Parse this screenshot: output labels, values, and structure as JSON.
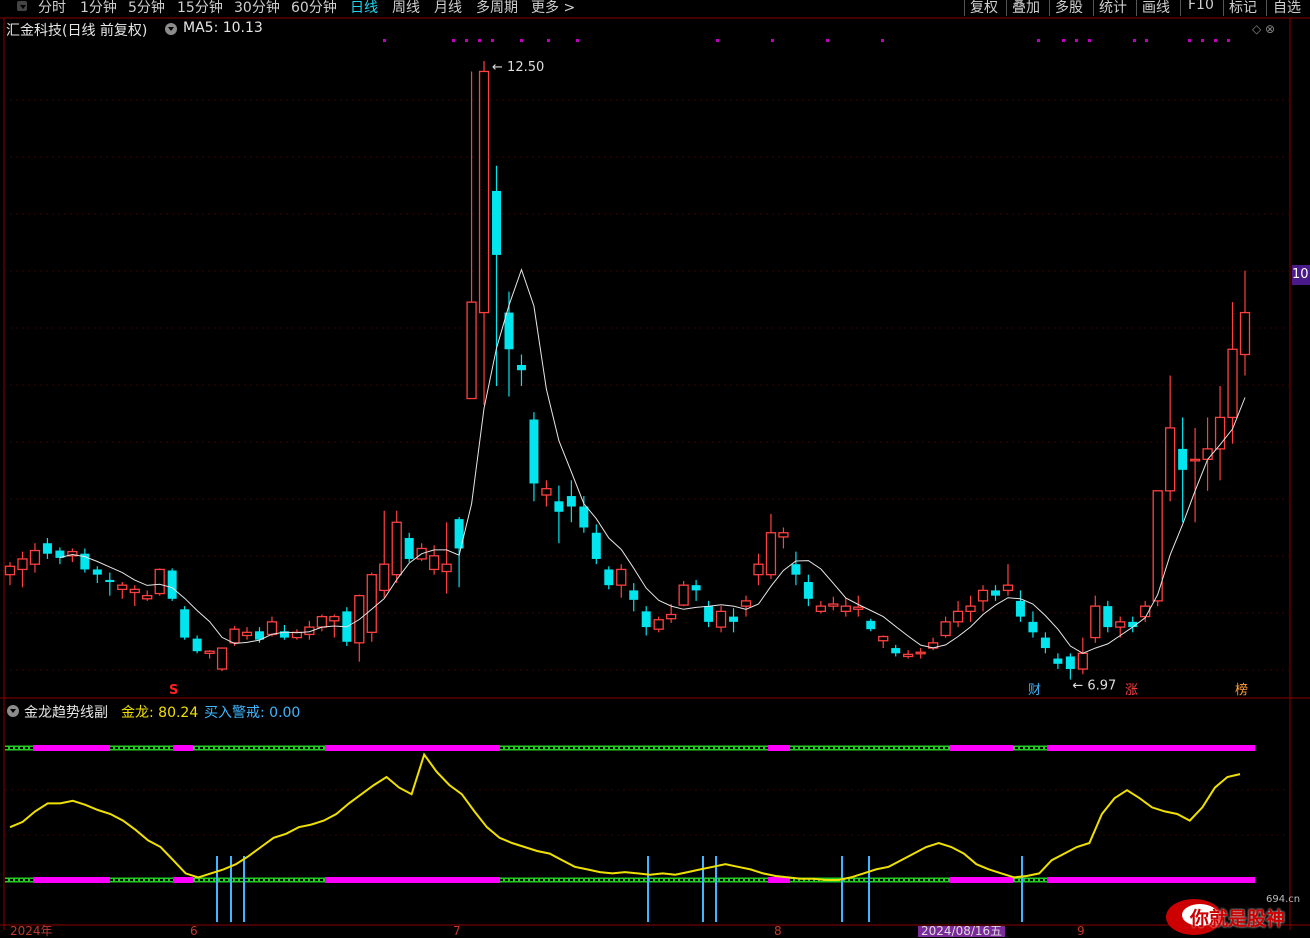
{
  "toolbar": {
    "periods": [
      "分时",
      "1分钟",
      "5分钟",
      "15分钟",
      "30分钟",
      "60分钟",
      "日线",
      "周线",
      "月线",
      "多周期",
      "更多 >"
    ],
    "active_period": "日线",
    "right_buttons": [
      "复权",
      "叠加",
      "多股",
      "统计",
      "画线",
      "F10",
      "标记",
      "自选"
    ]
  },
  "chart": {
    "title": "汇金科技(日线 前复权)",
    "ma_label": "MA5: 10.13",
    "high_label": "12.50",
    "low_label": "6.97",
    "right_price": "10",
    "markers": {
      "s": "S",
      "cai": "财",
      "zhang": "涨",
      "bang": "榜"
    }
  },
  "indicator": {
    "title": "金龙趋势线副",
    "gold_label": "金龙: 80.24",
    "alert_label": "买入警戒: 0.00"
  },
  "x_axis": {
    "labels": [
      "2024年",
      "6",
      "7",
      "8",
      "2024/08/16五",
      "9"
    ]
  },
  "watermark": {
    "text": "你就是股神",
    "site": "694.cn"
  },
  "colors": {
    "up": "#ff4040",
    "down": "#00e5ee",
    "ma": "#e6e6e6",
    "gold": "#f0e000",
    "magenta": "#ff00ff",
    "green": "#22cc22",
    "alert": "#3fb6ff"
  },
  "chart_data": {
    "type": "candlestick",
    "ma_period": 5,
    "candles": [
      [
        7.7,
        7.78,
        7.6,
        7.82
      ],
      [
        7.75,
        7.85,
        7.58,
        7.92
      ],
      [
        7.8,
        7.93,
        7.72,
        8.0
      ],
      [
        8.0,
        7.9,
        7.85,
        8.05
      ],
      [
        7.93,
        7.86,
        7.8,
        7.96
      ],
      [
        7.88,
        7.92,
        7.82,
        7.95
      ],
      [
        7.9,
        7.75,
        7.72,
        7.95
      ],
      [
        7.75,
        7.7,
        7.62,
        7.78
      ],
      [
        7.65,
        7.63,
        7.5,
        7.72
      ],
      [
        7.56,
        7.6,
        7.47,
        7.63
      ],
      [
        7.53,
        7.56,
        7.4,
        7.6
      ],
      [
        7.47,
        7.5,
        7.45,
        7.55
      ],
      [
        7.52,
        7.75,
        7.5,
        7.76
      ],
      [
        7.74,
        7.47,
        7.45,
        7.76
      ],
      [
        7.37,
        7.1,
        7.08,
        7.4
      ],
      [
        7.09,
        6.97,
        6.95,
        7.12
      ],
      [
        6.95,
        6.97,
        6.9,
        6.98
      ],
      [
        6.8,
        7.0,
        6.78,
        6.84
      ],
      [
        7.05,
        7.18,
        7.02,
        7.21
      ],
      [
        7.12,
        7.15,
        7.08,
        7.2
      ],
      [
        7.16,
        7.08,
        7.05,
        7.2
      ],
      [
        7.13,
        7.25,
        7.11,
        7.3
      ],
      [
        7.16,
        7.1,
        7.08,
        7.22
      ],
      [
        7.1,
        7.15,
        7.08,
        7.18
      ],
      [
        7.13,
        7.2,
        7.08,
        7.26
      ],
      [
        7.2,
        7.3,
        7.16,
        7.32
      ],
      [
        7.26,
        7.3,
        7.1,
        7.32
      ],
      [
        7.35,
        7.06,
        7.02,
        7.39
      ],
      [
        7.05,
        7.5,
        6.87,
        7.51
      ],
      [
        7.15,
        7.7,
        7.06,
        7.72
      ],
      [
        7.55,
        7.8,
        7.48,
        8.31
      ],
      [
        7.7,
        8.2,
        7.62,
        8.31
      ],
      [
        8.05,
        7.85,
        7.82,
        8.1
      ],
      [
        7.85,
        7.95,
        7.83,
        8.0
      ],
      [
        7.75,
        7.88,
        7.7,
        7.98
      ],
      [
        7.73,
        7.8,
        7.52,
        8.2
      ],
      [
        8.23,
        7.95,
        7.58,
        8.25
      ],
      [
        9.38,
        10.3,
        9.38,
        12.5
      ],
      [
        10.2,
        12.5,
        9.32,
        12.6
      ],
      [
        11.36,
        10.75,
        9.5,
        11.6
      ],
      [
        10.2,
        9.85,
        9.4,
        10.4
      ],
      [
        9.7,
        9.65,
        9.5,
        9.8
      ],
      [
        9.18,
        8.57,
        8.4,
        9.25
      ],
      [
        8.46,
        8.52,
        8.35,
        8.6
      ],
      [
        8.4,
        8.3,
        8.0,
        8.55
      ],
      [
        8.45,
        8.35,
        8.2,
        8.6
      ],
      [
        8.35,
        8.15,
        8.1,
        8.45
      ],
      [
        8.1,
        7.85,
        7.8,
        8.18
      ],
      [
        7.75,
        7.6,
        7.56,
        7.78
      ],
      [
        7.6,
        7.75,
        7.48,
        7.8
      ],
      [
        7.55,
        7.46,
        7.35,
        7.62
      ],
      [
        7.35,
        7.2,
        7.12,
        7.4
      ],
      [
        7.18,
        7.27,
        7.15,
        7.3
      ],
      [
        7.28,
        7.32,
        7.24,
        7.42
      ],
      [
        7.41,
        7.6,
        7.4,
        7.64
      ],
      [
        7.6,
        7.55,
        7.45,
        7.65
      ],
      [
        7.4,
        7.25,
        7.2,
        7.45
      ],
      [
        7.2,
        7.35,
        7.15,
        7.4
      ],
      [
        7.3,
        7.25,
        7.15,
        7.38
      ],
      [
        7.4,
        7.45,
        7.3,
        7.5
      ],
      [
        7.7,
        7.8,
        7.6,
        7.9
      ],
      [
        7.7,
        8.1,
        7.66,
        8.28
      ],
      [
        8.06,
        8.1,
        7.95,
        8.15
      ],
      [
        7.8,
        7.7,
        7.6,
        7.92
      ],
      [
        7.63,
        7.47,
        7.4,
        7.7
      ],
      [
        7.35,
        7.4,
        7.33,
        7.45
      ],
      [
        7.4,
        7.42,
        7.36,
        7.49
      ],
      [
        7.35,
        7.4,
        7.3,
        7.48
      ],
      [
        7.37,
        7.39,
        7.3,
        7.5
      ],
      [
        7.26,
        7.18,
        7.16,
        7.28
      ],
      [
        7.07,
        7.11,
        7.0,
        7.12
      ],
      [
        7.0,
        6.95,
        6.92,
        7.03
      ],
      [
        6.92,
        6.94,
        6.9,
        6.98
      ],
      [
        6.95,
        6.96,
        6.9,
        7.0
      ],
      [
        7.0,
        7.05,
        6.98,
        7.1
      ],
      [
        7.12,
        7.25,
        7.1,
        7.3
      ],
      [
        7.25,
        7.35,
        7.2,
        7.45
      ],
      [
        7.35,
        7.4,
        7.25,
        7.5
      ],
      [
        7.45,
        7.55,
        7.35,
        7.6
      ],
      [
        7.55,
        7.5,
        7.45,
        7.6
      ],
      [
        7.55,
        7.6,
        7.5,
        7.8
      ],
      [
        7.45,
        7.3,
        7.25,
        7.55
      ],
      [
        7.25,
        7.15,
        7.1,
        7.35
      ],
      [
        7.1,
        7.0,
        6.95,
        7.15
      ],
      [
        6.9,
        6.85,
        6.8,
        6.95
      ],
      [
        6.92,
        6.8,
        6.7,
        6.95
      ],
      [
        6.8,
        6.95,
        6.75,
        7.1
      ],
      [
        7.1,
        7.4,
        7.05,
        7.5
      ],
      [
        7.4,
        7.2,
        7.15,
        7.45
      ],
      [
        7.2,
        7.25,
        7.1,
        7.3
      ],
      [
        7.25,
        7.2,
        7.15,
        7.3
      ],
      [
        7.3,
        7.4,
        7.25,
        7.45
      ],
      [
        7.45,
        8.5,
        7.4,
        8.5
      ],
      [
        8.5,
        9.1,
        8.4,
        9.6
      ],
      [
        8.9,
        8.7,
        8.2,
        9.2
      ],
      [
        8.8,
        8.8,
        8.2,
        9.1
      ],
      [
        8.8,
        8.9,
        8.5,
        9.2
      ],
      [
        8.9,
        9.2,
        8.6,
        9.5
      ],
      [
        9.2,
        9.85,
        8.95,
        10.3
      ],
      [
        9.8,
        10.2,
        9.6,
        10.6
      ]
    ],
    "indicator_series": [
      {
        "name": "金龙",
        "values": [
          40,
          44,
          52,
          58,
          58,
          60,
          57,
          53,
          50,
          45,
          38,
          30,
          25,
          15,
          5,
          2,
          5,
          8,
          12,
          18,
          25,
          32,
          35,
          40,
          42,
          45,
          50,
          58,
          65,
          72,
          78,
          70,
          65,
          95,
          82,
          72,
          65,
          52,
          40,
          32,
          28,
          25,
          22,
          20,
          15,
          10,
          8,
          6,
          5,
          6,
          5,
          4,
          5,
          4,
          6,
          8,
          10,
          12,
          10,
          8,
          5,
          3,
          2,
          1,
          1,
          0,
          0,
          2,
          5,
          8,
          10,
          15,
          20,
          25,
          28,
          25,
          20,
          12,
          8,
          5,
          2,
          3,
          5,
          15,
          20,
          25,
          28,
          50,
          62,
          68,
          62,
          55,
          52,
          50,
          45,
          55,
          70,
          78,
          80.24
        ]
      },
      {
        "name": "买入警戒",
        "values": [
          0
        ]
      }
    ],
    "ylim": [
      6.6,
      12.8
    ]
  }
}
